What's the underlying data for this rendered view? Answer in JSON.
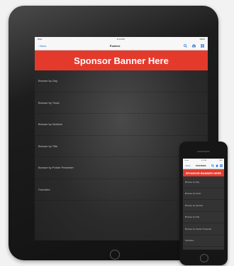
{
  "tablet": {
    "status": {
      "left": "iPad",
      "time": "3:13 PM",
      "battery": "100%"
    },
    "nav": {
      "back_label": "Back",
      "title": "Posters"
    },
    "banner": "Sponsor Banner Here",
    "menu_items": [
      "Browse by Day",
      "Browse by Track",
      "Browse by Number",
      "Browse by Title",
      "Browse by Poster Presenter",
      "Favorites"
    ]
  },
  "phone": {
    "status": {
      "left": "Carrier",
      "time": "3:13 PM",
      "battery": "100%"
    },
    "nav": {
      "back_label": "Back",
      "title": "POSTERS"
    },
    "banner": "SPONSOR BANNER HERE",
    "menu_items": [
      "Browse by Day",
      "Browse by Track",
      "Browse by Number",
      "Browse by Title",
      "Browse by Poster Presenter",
      "Favorites"
    ]
  },
  "colors": {
    "accent": "#e43a2c",
    "link": "#2a78d6"
  }
}
